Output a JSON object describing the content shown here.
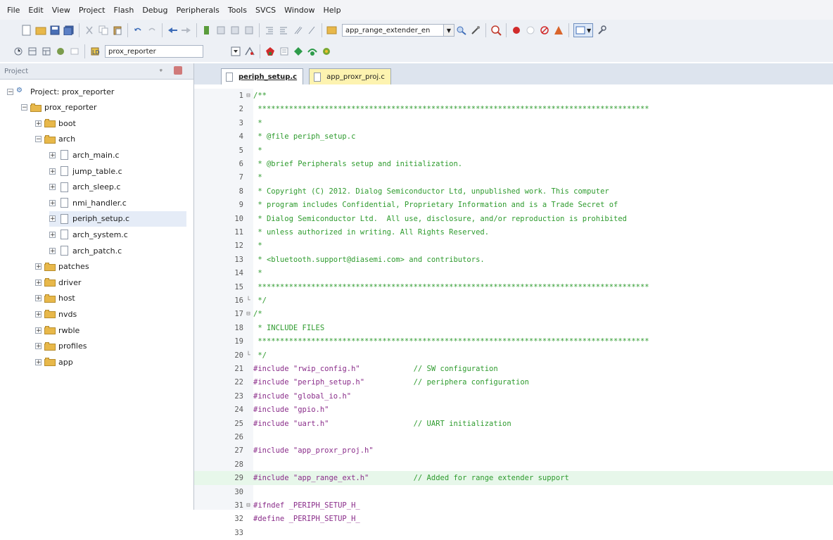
{
  "menu": [
    "File",
    "Edit",
    "View",
    "Project",
    "Flash",
    "Debug",
    "Peripherals",
    "Tools",
    "SVCS",
    "Window",
    "Help"
  ],
  "toolbar1": {
    "target_combo": "app_range_extender_en"
  },
  "toolbar2": {
    "project_combo": "prox_reporter"
  },
  "panel": {
    "title": "Project",
    "tree": [
      {
        "label": "Project: prox_reporter",
        "type": "project",
        "level": 0,
        "expander": "−"
      },
      {
        "label": "prox_reporter",
        "type": "folder",
        "level": 1,
        "expander": "−"
      },
      {
        "label": "boot",
        "type": "folder",
        "level": 2,
        "expander": "+"
      },
      {
        "label": "arch",
        "type": "folder",
        "level": 2,
        "expander": "−"
      },
      {
        "label": "arch_main.c",
        "type": "file",
        "level": 3,
        "expander": "+"
      },
      {
        "label": "jump_table.c",
        "type": "file",
        "level": 3,
        "expander": "+"
      },
      {
        "label": "arch_sleep.c",
        "type": "file",
        "level": 3,
        "expander": "+"
      },
      {
        "label": "nmi_handler.c",
        "type": "file",
        "level": 3,
        "expander": "+"
      },
      {
        "label": "periph_setup.c",
        "type": "file",
        "level": 3,
        "expander": "+",
        "selected": true
      },
      {
        "label": "arch_system.c",
        "type": "file",
        "level": 3,
        "expander": "+"
      },
      {
        "label": "arch_patch.c",
        "type": "file",
        "level": 3,
        "expander": "+"
      },
      {
        "label": "patches",
        "type": "folder",
        "level": 2,
        "expander": "+"
      },
      {
        "label": "driver",
        "type": "folder",
        "level": 2,
        "expander": "+"
      },
      {
        "label": "host",
        "type": "folder",
        "level": 2,
        "expander": "+"
      },
      {
        "label": "nvds",
        "type": "folder",
        "level": 2,
        "expander": "+"
      },
      {
        "label": "rwble",
        "type": "folder",
        "level": 2,
        "expander": "+"
      },
      {
        "label": "profiles",
        "type": "folder",
        "level": 2,
        "expander": "+"
      },
      {
        "label": "app",
        "type": "folder",
        "level": 2,
        "expander": "+"
      }
    ]
  },
  "tabs": [
    {
      "label": "periph_setup.c",
      "active": true
    },
    {
      "label": "app_proxr_proj.c",
      "active": false
    }
  ],
  "code": [
    {
      "n": "1",
      "fold": "⊟",
      "kind": "cmt",
      "text": "/**"
    },
    {
      "n": "2",
      "fold": "",
      "kind": "cmt",
      "text": " ****************************************************************************************"
    },
    {
      "n": "3",
      "fold": "",
      "kind": "cmt",
      "text": " *"
    },
    {
      "n": "4",
      "fold": "",
      "kind": "cmt",
      "text": " * @file periph_setup.c"
    },
    {
      "n": "5",
      "fold": "",
      "kind": "cmt",
      "text": " *"
    },
    {
      "n": "6",
      "fold": "",
      "kind": "cmt",
      "text": " * @brief Peripherals setup and initialization."
    },
    {
      "n": "7",
      "fold": "",
      "kind": "cmt",
      "text": " *"
    },
    {
      "n": "8",
      "fold": "",
      "kind": "cmt",
      "text": " * Copyright (C) 2012. Dialog Semiconductor Ltd, unpublished work. This computer"
    },
    {
      "n": "9",
      "fold": "",
      "kind": "cmt",
      "text": " * program includes Confidential, Proprietary Information and is a Trade Secret of"
    },
    {
      "n": "10",
      "fold": "",
      "kind": "cmt",
      "text": " * Dialog Semiconductor Ltd.  All use, disclosure, and/or reproduction is prohibited"
    },
    {
      "n": "11",
      "fold": "",
      "kind": "cmt",
      "text": " * unless authorized in writing. All Rights Reserved."
    },
    {
      "n": "12",
      "fold": "",
      "kind": "cmt",
      "text": " *"
    },
    {
      "n": "13",
      "fold": "",
      "kind": "cmt",
      "text": " * <bluetooth.support@diasemi.com> and contributors."
    },
    {
      "n": "14",
      "fold": "",
      "kind": "cmt",
      "text": " *"
    },
    {
      "n": "15",
      "fold": "",
      "kind": "cmt",
      "text": " ****************************************************************************************"
    },
    {
      "n": "16",
      "fold": "└",
      "kind": "cmt",
      "text": " */"
    },
    {
      "n": "17",
      "fold": "⊟",
      "kind": "cmt",
      "text": "/*"
    },
    {
      "n": "18",
      "fold": "",
      "kind": "cmt",
      "text": " * INCLUDE FILES"
    },
    {
      "n": "19",
      "fold": "",
      "kind": "cmt",
      "text": " ****************************************************************************************"
    },
    {
      "n": "20",
      "fold": "└",
      "kind": "cmt",
      "text": " */"
    },
    {
      "n": "21",
      "fold": "",
      "kind": "inc",
      "pre": "#include ",
      "str": "\"rwip_config.h\"",
      "pad": "            ",
      "cmt": "// SW configuration"
    },
    {
      "n": "22",
      "fold": "",
      "kind": "inc",
      "pre": "#include ",
      "str": "\"periph_setup.h\"",
      "pad": "           ",
      "cmt": "// periphera configuration"
    },
    {
      "n": "23",
      "fold": "",
      "kind": "inc",
      "pre": "#include ",
      "str": "\"global_io.h\"",
      "pad": "",
      "cmt": ""
    },
    {
      "n": "24",
      "fold": "",
      "kind": "inc",
      "pre": "#include ",
      "str": "\"gpio.h\"",
      "pad": "",
      "cmt": ""
    },
    {
      "n": "25",
      "fold": "",
      "kind": "inc",
      "pre": "#include ",
      "str": "\"uart.h\"",
      "pad": "                   ",
      "cmt": "// UART initialization"
    },
    {
      "n": "26",
      "fold": "",
      "kind": "blank",
      "text": ""
    },
    {
      "n": "27",
      "fold": "",
      "kind": "inc",
      "pre": "#include ",
      "str": "\"app_proxr_proj.h\"",
      "pad": "",
      "cmt": ""
    },
    {
      "n": "28",
      "fold": "",
      "kind": "blank",
      "text": ""
    },
    {
      "n": "29",
      "fold": "",
      "kind": "inc",
      "pre": "#include ",
      "str": "\"app_range_ext.h\"",
      "pad": "          ",
      "cmt": "// Added for range extender support",
      "highlight": true
    },
    {
      "n": "30",
      "fold": "",
      "kind": "blank",
      "text": ""
    },
    {
      "n": "31",
      "fold": "⊟",
      "kind": "def",
      "pre": "#ifndef ",
      "rest": "_PERIPH_SETUP_H_"
    },
    {
      "n": "32",
      "fold": "",
      "kind": "def",
      "pre": "#define ",
      "rest": "_PERIPH_SETUP_H_"
    },
    {
      "n": "33",
      "fold": "",
      "kind": "blank",
      "text": ""
    }
  ],
  "colors": {
    "comment": "#2e9b2e",
    "preprocessor": "#8a2d8a",
    "highlight_line": "#e7f7ea",
    "active_tab_bg": "#ffffff",
    "inactive_tab_bg": "#fdf3b0"
  }
}
